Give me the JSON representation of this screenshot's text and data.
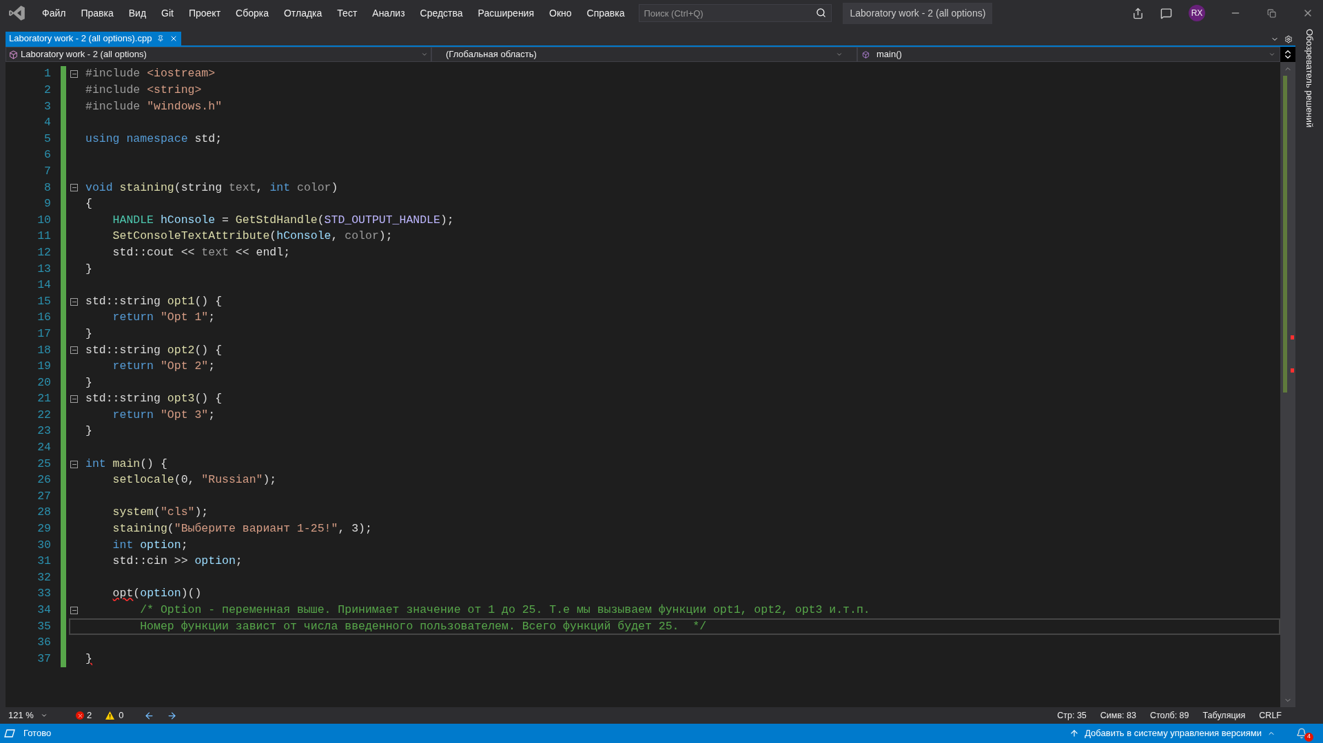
{
  "menu": [
    "Файл",
    "Правка",
    "Вид",
    "Git",
    "Проект",
    "Сборка",
    "Отладка",
    "Тест",
    "Анализ",
    "Средства",
    "Расширения",
    "Окно",
    "Справка"
  ],
  "search": {
    "placeholder": "Поиск (Ctrl+Q)"
  },
  "solution_title": "Laboratory work - 2 (all options)",
  "avatar": "RX",
  "tabs": [
    {
      "label": "Laboratory work - 2 (all options).cpp",
      "selected": true
    }
  ],
  "nav": {
    "project": "Laboratory work - 2 (all options)",
    "scope": "(Глобальная область)",
    "member": "main()"
  },
  "code": [
    {
      "number": "1",
      "fold": true,
      "tokens": [
        {
          "kind": "pre",
          "t": "#include "
        },
        {
          "kind": "str",
          "t": "<iostream>"
        }
      ]
    },
    {
      "number": "2",
      "fold": false,
      "tokens": [
        {
          "kind": "pre",
          "t": "#include "
        },
        {
          "kind": "str",
          "t": "<string>"
        }
      ]
    },
    {
      "number": "3",
      "fold": false,
      "tokens": [
        {
          "kind": "pre",
          "t": "#include "
        },
        {
          "kind": "str",
          "t": "\"windows.h\""
        }
      ]
    },
    {
      "number": "4",
      "fold": false
    },
    {
      "number": "5",
      "fold": false,
      "tokens": [
        {
          "kind": "kw",
          "t": "using "
        },
        {
          "kind": "kw",
          "t": "namespace"
        },
        {
          "kind": "plain",
          "t": " std;"
        }
      ]
    },
    {
      "number": "6",
      "fold": false
    },
    {
      "number": "7",
      "fold": false
    },
    {
      "number": "8",
      "fold": true,
      "tokens": [
        {
          "kind": "kw",
          "t": "void "
        },
        {
          "kind": "func",
          "t": "staining"
        },
        {
          "kind": "plain",
          "t": "(string "
        },
        {
          "kind": "param",
          "t": "text"
        },
        {
          "kind": "plain",
          "t": ", "
        },
        {
          "kind": "kw",
          "t": "int "
        },
        {
          "kind": "param",
          "t": "color"
        },
        {
          "kind": "plain",
          "t": ")"
        }
      ]
    },
    {
      "number": "9",
      "fold": false,
      "tokens": [
        {
          "kind": "plain",
          "t": "{"
        }
      ]
    },
    {
      "number": "10",
      "fold": false,
      "tokens": [
        {
          "kind": "type",
          "t": "    HANDLE "
        },
        {
          "kind": "var",
          "t": "hConsole"
        },
        {
          "kind": "plain",
          "t": " = "
        },
        {
          "kind": "func",
          "t": "GetStdHandle"
        },
        {
          "kind": "plain",
          "t": "("
        },
        {
          "kind": "macro",
          "t": "STD_OUTPUT_HANDLE"
        },
        {
          "kind": "plain",
          "t": ");"
        }
      ]
    },
    {
      "number": "11",
      "fold": false,
      "tokens": [
        {
          "kind": "func",
          "t": "    SetConsoleTextAttribute"
        },
        {
          "kind": "plain",
          "t": "("
        },
        {
          "kind": "var",
          "t": "hConsole"
        },
        {
          "kind": "plain",
          "t": ", "
        },
        {
          "kind": "param",
          "t": "color"
        },
        {
          "kind": "plain",
          "t": ");"
        }
      ]
    },
    {
      "number": "12",
      "fold": false,
      "tokens": [
        {
          "kind": "plain",
          "t": "    std::cout << "
        },
        {
          "kind": "param",
          "t": "text"
        },
        {
          "kind": "plain",
          "t": " << endl;"
        }
      ]
    },
    {
      "number": "13",
      "fold": false,
      "tokens": [
        {
          "kind": "plain",
          "t": "}"
        }
      ]
    },
    {
      "number": "14",
      "fold": false
    },
    {
      "number": "15",
      "fold": true,
      "tokens": [
        {
          "kind": "plain",
          "t": "std::string "
        },
        {
          "kind": "func",
          "t": "opt1"
        },
        {
          "kind": "plain",
          "t": "() {"
        }
      ]
    },
    {
      "number": "16",
      "fold": false,
      "tokens": [
        {
          "kind": "kw",
          "t": "    return "
        },
        {
          "kind": "str",
          "t": "\"Opt 1\""
        },
        {
          "kind": "plain",
          "t": ";"
        }
      ]
    },
    {
      "number": "17",
      "fold": false,
      "tokens": [
        {
          "kind": "plain",
          "t": "}"
        }
      ]
    },
    {
      "number": "18",
      "fold": true,
      "tokens": [
        {
          "kind": "plain",
          "t": "std::string "
        },
        {
          "kind": "func",
          "t": "opt2"
        },
        {
          "kind": "plain",
          "t": "() {"
        }
      ]
    },
    {
      "number": "19",
      "fold": false,
      "tokens": [
        {
          "kind": "kw",
          "t": "    return "
        },
        {
          "kind": "str",
          "t": "\"Opt 2\""
        },
        {
          "kind": "plain",
          "t": ";"
        }
      ]
    },
    {
      "number": "20",
      "fold": false,
      "tokens": [
        {
          "kind": "plain",
          "t": "}"
        }
      ]
    },
    {
      "number": "21",
      "fold": true,
      "tokens": [
        {
          "kind": "plain",
          "t": "std::string "
        },
        {
          "kind": "func",
          "t": "opt3"
        },
        {
          "kind": "plain",
          "t": "() {"
        }
      ]
    },
    {
      "number": "22",
      "fold": false,
      "tokens": [
        {
          "kind": "kw",
          "t": "    return "
        },
        {
          "kind": "str",
          "t": "\"Opt 3\""
        },
        {
          "kind": "plain",
          "t": ";"
        }
      ]
    },
    {
      "number": "23",
      "fold": false,
      "tokens": [
        {
          "kind": "plain",
          "t": "}"
        }
      ]
    },
    {
      "number": "24",
      "fold": false
    },
    {
      "number": "25",
      "fold": true,
      "tokens": [
        {
          "kind": "kw",
          "t": "int "
        },
        {
          "kind": "func",
          "t": "main"
        },
        {
          "kind": "plain",
          "t": "() {"
        }
      ]
    },
    {
      "number": "26",
      "fold": false,
      "tokens": [
        {
          "kind": "func",
          "t": "    setlocale"
        },
        {
          "kind": "plain",
          "t": "(0, "
        },
        {
          "kind": "str",
          "t": "\"Russian\""
        },
        {
          "kind": "plain",
          "t": ");"
        }
      ]
    },
    {
      "number": "27",
      "fold": false
    },
    {
      "number": "28",
      "fold": false,
      "tokens": [
        {
          "kind": "func",
          "t": "    system"
        },
        {
          "kind": "plain",
          "t": "("
        },
        {
          "kind": "str",
          "t": "\"cls\""
        },
        {
          "kind": "plain",
          "t": ");"
        }
      ]
    },
    {
      "number": "29",
      "fold": false,
      "tokens": [
        {
          "kind": "func",
          "t": "    staining"
        },
        {
          "kind": "plain",
          "t": "("
        },
        {
          "kind": "str",
          "t": "\"Выберите вариант 1-25!\""
        },
        {
          "kind": "plain",
          "t": ", 3);"
        }
      ]
    },
    {
      "number": "30",
      "fold": false,
      "tokens": [
        {
          "kind": "kw",
          "t": "    int "
        },
        {
          "kind": "var",
          "t": "option"
        },
        {
          "kind": "plain",
          "t": ";"
        }
      ]
    },
    {
      "number": "31",
      "fold": false,
      "tokens": [
        {
          "kind": "plain",
          "t": "    std::cin >> "
        },
        {
          "kind": "var",
          "t": "option"
        },
        {
          "kind": "plain",
          "t": ";"
        }
      ]
    },
    {
      "number": "32",
      "fold": false
    },
    {
      "number": "33",
      "fold": false,
      "tokens": [
        {
          "kind": "error",
          "t": "    opt"
        },
        {
          "kind": "plain",
          "t": "("
        },
        {
          "kind": "var",
          "t": "option"
        },
        {
          "kind": "plain",
          "t": ")()"
        }
      ]
    },
    {
      "number": "34",
      "fold": true,
      "tokens": [
        {
          "kind": "comment",
          "t": "        /* Option - переменная выше. Принимает значение от 1 до 25. Т.е мы вызываем функции opt1, opt2, opt3 и.т.п."
        }
      ]
    },
    {
      "number": "35",
      "fold": false,
      "current": true,
      "tokens": [
        {
          "kind": "comment",
          "t": "        Номер функции завист от числа введенного пользователем. Всего функций будет 25.  */"
        }
      ]
    },
    {
      "number": "36",
      "fold": false
    },
    {
      "number": "37",
      "fold": false,
      "tokens": [
        {
          "kind": "error",
          "t": "}"
        }
      ]
    }
  ],
  "editor_footer": {
    "zoom": "121 %",
    "errors": "2",
    "warnings": "0",
    "position": [
      "Стр: 35",
      "Симв: 83",
      "Столб: 89",
      "Табуляция",
      "CRLF"
    ]
  },
  "side_panel": "Обозреватель решений",
  "status_bar": {
    "state": "Готово",
    "source_control": "Добавить в систему управления версиями",
    "notifications": "4"
  }
}
